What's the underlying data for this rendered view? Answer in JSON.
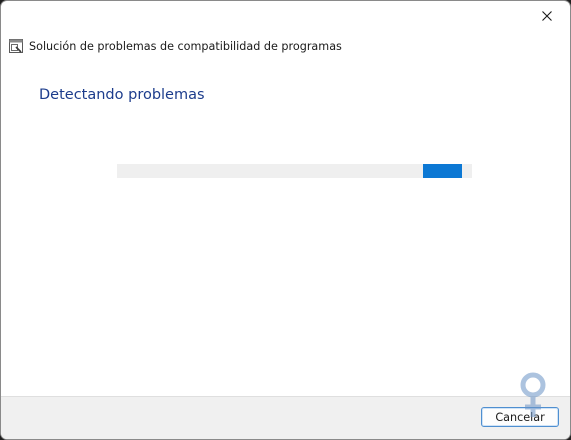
{
  "window": {
    "title": "Solución de problemas de compatibilidad de programas",
    "close_icon": "close-icon",
    "app_icon": "troubleshooter-app-icon"
  },
  "main": {
    "heading": "Detectando problemas",
    "progress": {
      "style": "indeterminate-marquee",
      "segment_start_fraction": 0.862,
      "segment_width_fraction": 0.11,
      "track_color": "#efefef",
      "fill_color": "#0c78d4"
    }
  },
  "footer": {
    "cancel_label": "Cancelar"
  },
  "colors": {
    "heading": "#1c3c8c",
    "accent": "#0c78d4",
    "footer_bg": "#f0f0f0"
  }
}
